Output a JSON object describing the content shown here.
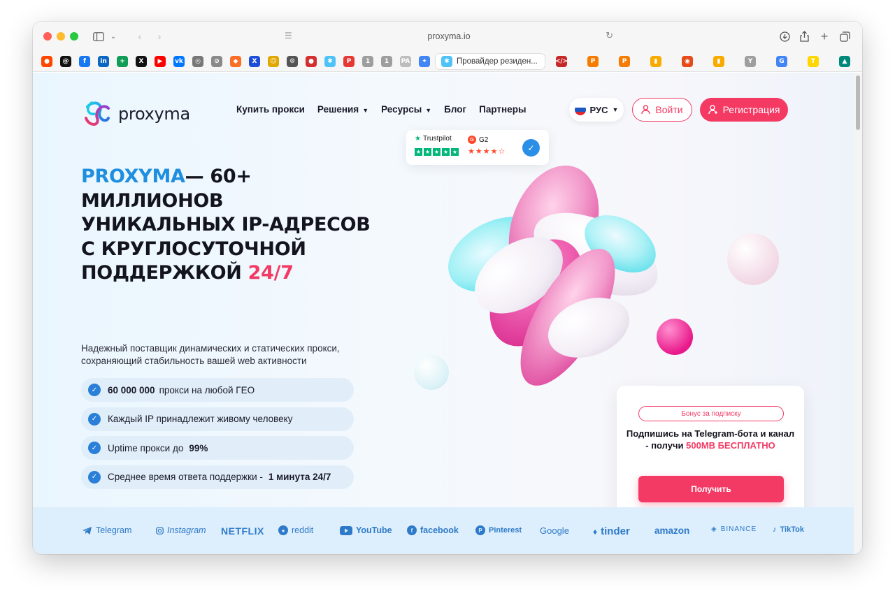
{
  "browser": {
    "url": "proxyma.io",
    "bookmark_tab_label": "Провайдер резиден..."
  },
  "bookmarks": [
    {
      "icon": "reddit-icon",
      "glyph": "●",
      "color": "#ff4500"
    },
    {
      "icon": "threads-icon",
      "glyph": "@",
      "color": "#111111"
    },
    {
      "icon": "facebook-icon",
      "glyph": "f",
      "color": "#1877f2"
    },
    {
      "icon": "linkedin-icon",
      "glyph": "in",
      "color": "#0a66c2"
    },
    {
      "icon": "sheets-icon",
      "glyph": "+",
      "color": "#0f9d58"
    },
    {
      "icon": "x-icon",
      "glyph": "X",
      "color": "#111111"
    },
    {
      "icon": "youtube-icon",
      "glyph": "▶",
      "color": "#ff0000"
    },
    {
      "icon": "vk-icon",
      "glyph": "vk",
      "color": "#0077ff"
    },
    {
      "icon": "globe-icon",
      "glyph": "◎",
      "color": "#777777"
    },
    {
      "icon": "compass-icon",
      "glyph": "⊘",
      "color": "#8a8a8a"
    },
    {
      "icon": "gitlab-icon",
      "glyph": "◆",
      "color": "#fc6d26"
    },
    {
      "icon": "x-blue-icon",
      "glyph": "X",
      "color": "#1d4ed8"
    },
    {
      "icon": "sticker-icon",
      "glyph": "☺",
      "color": "#e0a800"
    },
    {
      "icon": "gear-icon",
      "glyph": "⚙",
      "color": "#555555"
    },
    {
      "icon": "pin-icon",
      "glyph": "●",
      "color": "#d32f2f"
    },
    {
      "icon": "proxyma-icon",
      "glyph": "✱",
      "color": "#4fc3f7"
    },
    {
      "icon": "p-icon",
      "glyph": "P",
      "color": "#e53935"
    },
    {
      "icon": "one-icon",
      "glyph": "1",
      "color": "#9e9e9e"
    },
    {
      "icon": "one-alt-icon",
      "glyph": "1",
      "color": "#9e9e9e"
    },
    {
      "icon": "pa-icon",
      "glyph": "PA",
      "color": "#bdbdbd"
    },
    {
      "icon": "gemini-icon",
      "glyph": "✦",
      "color": "#4285f4"
    }
  ],
  "bookmarks_right": [
    {
      "icon": "code-icon",
      "glyph": "</>",
      "color": "#c62828"
    },
    {
      "icon": "p-orange-icon",
      "glyph": "P",
      "color": "#f57c00"
    },
    {
      "icon": "p-orange-alt-icon",
      "glyph": "P",
      "color": "#f57c00"
    },
    {
      "icon": "analytics-icon",
      "glyph": "▮",
      "color": "#f9ab00"
    },
    {
      "icon": "dot-red-icon",
      "glyph": "◉",
      "color": "#e64a19"
    },
    {
      "icon": "analytics-alt-icon",
      "glyph": "▮",
      "color": "#f9ab00"
    },
    {
      "icon": "y-icon",
      "glyph": "Y",
      "color": "#9e9e9e"
    },
    {
      "icon": "google-icon",
      "glyph": "G",
      "color": "#4285f4"
    },
    {
      "icon": "t-icon",
      "glyph": "T",
      "color": "#ffd600"
    },
    {
      "icon": "chart-icon",
      "glyph": "▲",
      "color": "#00897b"
    }
  ],
  "site": {
    "logo_text": "proxyma",
    "nav": [
      {
        "label": "Купить прокси",
        "dropdown": false
      },
      {
        "label": "Решения",
        "dropdown": true
      },
      {
        "label": "Ресурсы",
        "dropdown": true
      },
      {
        "label": "Блог",
        "dropdown": false
      },
      {
        "label": "Партнеры",
        "dropdown": false
      }
    ],
    "language": "РУС",
    "login": "Войти",
    "register": "Регистрация"
  },
  "ratings": {
    "trustpilot_label": "Trustpilot",
    "g2_label": "G2"
  },
  "hero": {
    "brand": "PROXYMA",
    "title_main": "— 60+ МИЛЛИОНОВ УНИКАЛЬНЫХ IP-АДРЕСОВ С КРУГЛОСУТОЧНОЙ ПОДДЕРЖКОЙ",
    "title_accent": "24/7",
    "subtitle": "Надежный поставщик динамических и статических прокси, сохраняющий стабильность вашей web активности",
    "features": [
      {
        "bold": "60 000 000",
        "text": "прокси на любой ГЕО",
        "bold_after": ""
      },
      {
        "bold": "",
        "text": "Каждый IP принадлежит живому человеку",
        "bold_after": ""
      },
      {
        "bold": "",
        "text": "Uptime прокси до",
        "bold_after": "99%"
      },
      {
        "bold": "",
        "text": "Среднее время ответа поддержки -",
        "bold_after": "1 минута 24/7"
      }
    ]
  },
  "promo": {
    "tag": "Бонус за подписку",
    "text": "Подпишись на Telegram-бота и канал - получи",
    "highlight": "500MB БЕСПЛАТНО",
    "button": "Получить"
  },
  "brands": [
    "Telegram",
    "Instagram",
    "NETFLIX",
    "reddit",
    "YouTube",
    "facebook",
    "Pinterest",
    "Google",
    "tinder",
    "amazon",
    "BINANCE",
    "TikTok"
  ],
  "colors": {
    "accent": "#f33a64",
    "brand_blue": "#1e8fe0",
    "chat": "#1479e0"
  }
}
